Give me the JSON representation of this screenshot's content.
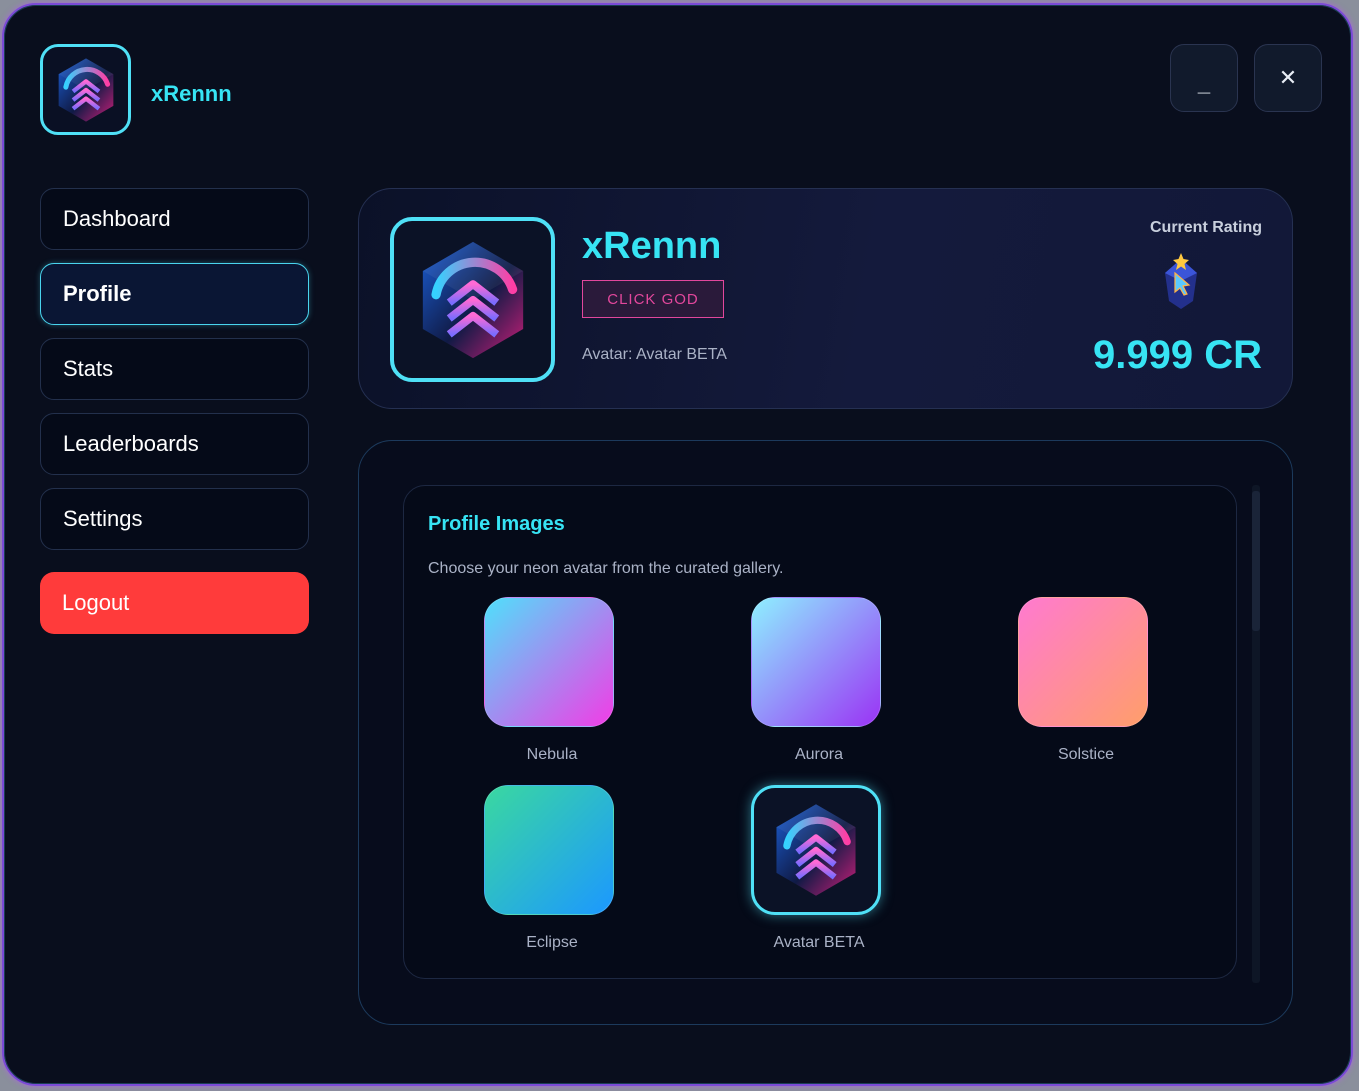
{
  "app": {
    "name": "xRennn"
  },
  "window_controls": {
    "minimize": "_",
    "close": "✕"
  },
  "nav": {
    "items": [
      {
        "label": "Dashboard",
        "active": false
      },
      {
        "label": "Profile",
        "active": true
      },
      {
        "label": "Stats",
        "active": false
      },
      {
        "label": "Leaderboards",
        "active": false
      },
      {
        "label": "Settings",
        "active": false
      }
    ],
    "logout": "Logout"
  },
  "profile": {
    "username": "xRennn",
    "badge": "CLICK GOD",
    "avatar_line": "Avatar: Avatar BETA",
    "rating_label": "Current Rating",
    "rating_value": "9.999 CR"
  },
  "gallery": {
    "title": "Profile Images",
    "description": "Choose your neon avatar from the curated gallery.",
    "items": [
      {
        "label": "Nebula",
        "colors": [
          "#4fe0fb",
          "#f23ce6"
        ]
      },
      {
        "label": "Aurora",
        "colors": [
          "#8ef0ff",
          "#9a33f5"
        ]
      },
      {
        "label": "Solstice",
        "colors": [
          "#ff7ad0",
          "#ff9e6a"
        ]
      },
      {
        "label": "Eclipse",
        "colors": [
          "#3ad8a0",
          "#1c98ff"
        ]
      },
      {
        "label": "Avatar BETA",
        "selected": true
      }
    ]
  },
  "colors": {
    "accent": "#37e4f4",
    "badge": "#e2479c",
    "logout": "#ff3b3b",
    "background": "#090e1d"
  }
}
